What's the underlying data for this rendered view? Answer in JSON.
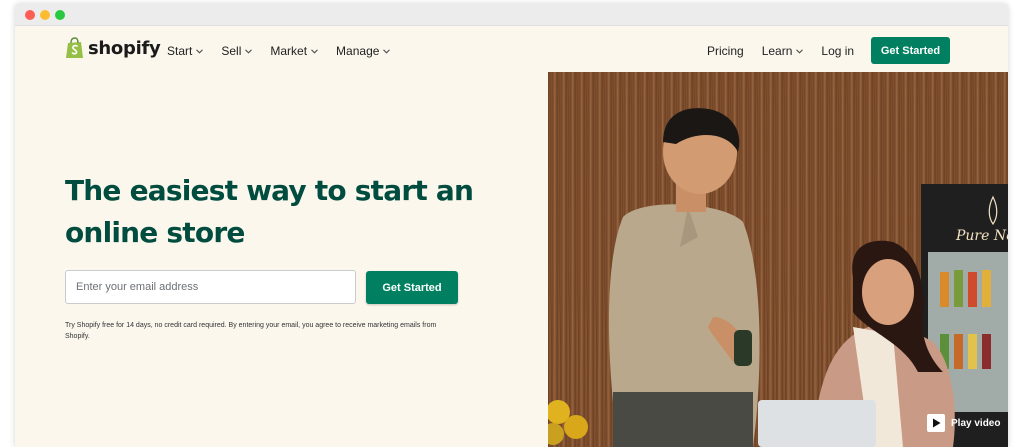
{
  "window": {
    "controls": [
      "close",
      "minimize",
      "maximize"
    ]
  },
  "brand": {
    "name": "shopify",
    "icon": "shopping-bag-icon",
    "color": "#95bf47"
  },
  "nav": {
    "left_items": [
      {
        "label": "Start",
        "has_dropdown": true
      },
      {
        "label": "Sell",
        "has_dropdown": true
      },
      {
        "label": "Market",
        "has_dropdown": true
      },
      {
        "label": "Manage",
        "has_dropdown": true
      }
    ],
    "right_items": [
      {
        "label": "Pricing",
        "has_dropdown": false
      },
      {
        "label": "Learn",
        "has_dropdown": true
      },
      {
        "label": "Log in",
        "has_dropdown": false
      }
    ],
    "cta_label": "Get Started"
  },
  "hero": {
    "headline_line1": "The easiest way to start an",
    "headline_line2": "online store",
    "email_placeholder": "Enter your email address",
    "email_value": "",
    "cta_label": "Get Started",
    "disclaimer": "Try Shopify free for 14 days, no credit card required. By entering your email, you agree to receive marketing emails from Shopify.",
    "image_sign_text": "Pure Ne",
    "play_label": "Play video"
  },
  "colors": {
    "primary_green": "#008060",
    "headline_green": "#004c3f",
    "background": "#fbf7ed"
  }
}
